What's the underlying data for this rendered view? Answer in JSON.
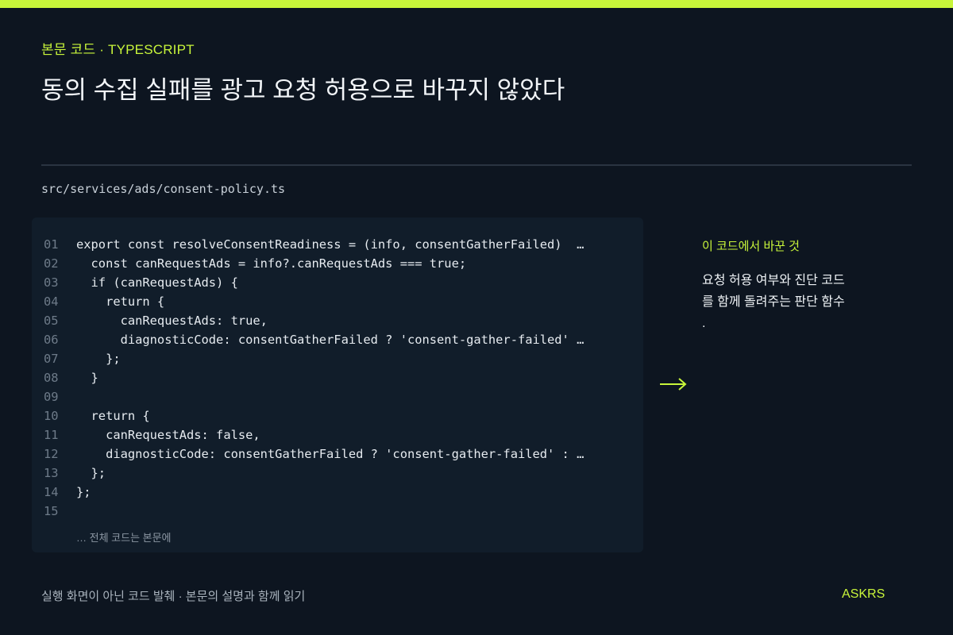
{
  "colors": {
    "accent": "#c8f53a",
    "background": "#0d1520",
    "code_panel": "#111d2a",
    "line_number": "#6e7b89"
  },
  "header": {
    "eyebrow": "본문 코드 · TYPESCRIPT",
    "title": "동의 수집 실패를 광고 요청 허용으로 바꾸지 않았다"
  },
  "file": {
    "path": "src/services/ads/consent-policy.ts"
  },
  "code": {
    "lines": [
      {
        "num": "01",
        "text": "export const resolveConsentReadiness = (info, consentGatherFailed)  …"
      },
      {
        "num": "02",
        "text": "  const canRequestAds = info?.canRequestAds === true;"
      },
      {
        "num": "03",
        "text": "  if (canRequestAds) {"
      },
      {
        "num": "04",
        "text": "    return {"
      },
      {
        "num": "05",
        "text": "      canRequestAds: true,"
      },
      {
        "num": "06",
        "text": "      diagnosticCode: consentGatherFailed ? 'consent-gather-failed' …"
      },
      {
        "num": "07",
        "text": "    };"
      },
      {
        "num": "08",
        "text": "  }"
      },
      {
        "num": "09",
        "text": ""
      },
      {
        "num": "10",
        "text": "  return {"
      },
      {
        "num": "11",
        "text": "    canRequestAds: false,"
      },
      {
        "num": "12",
        "text": "    diagnosticCode: consentGatherFailed ? 'consent-gather-failed' : …"
      },
      {
        "num": "13",
        "text": "  };"
      },
      {
        "num": "14",
        "text": "};"
      },
      {
        "num": "15",
        "text": ""
      }
    ],
    "more_note": "… 전체 코드는 본문에"
  },
  "side": {
    "arrow_icon": "arrow-right-icon",
    "label": "이 코드에서 바꾼 것",
    "desc_lines": [
      "요청 허용 여부와 진단 코드",
      "를 함께 돌려주는 판단 함수",
      "."
    ]
  },
  "footer": {
    "note": "실행 화면이 아닌 코드 발췌 · 본문의 설명과 함께 읽기",
    "brand": "ASKRS"
  }
}
